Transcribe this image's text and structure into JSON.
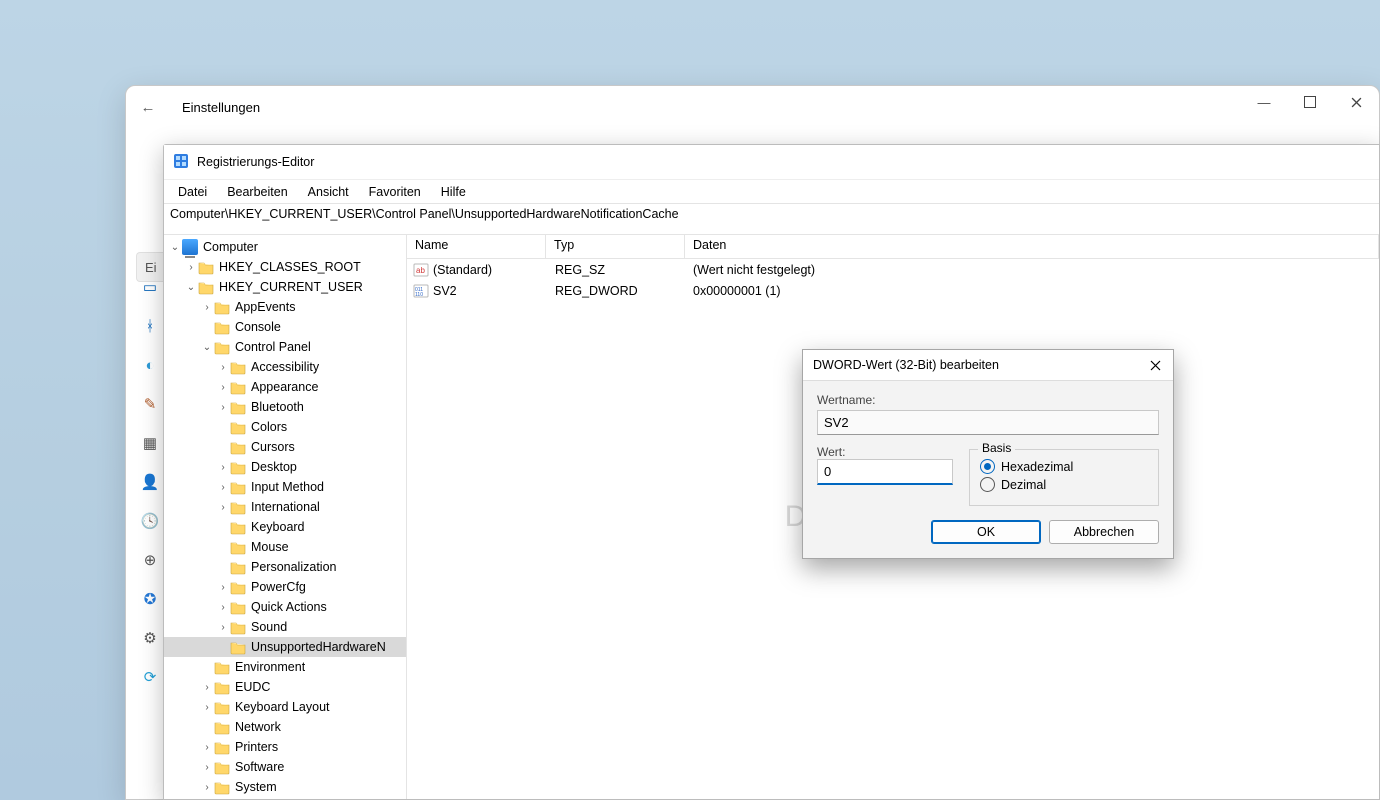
{
  "settings_window": {
    "title": "Einstellungen",
    "search_placeholder_fragment": "Ei"
  },
  "regedit": {
    "title": "Registrierungs-Editor",
    "menu": {
      "file": "Datei",
      "edit": "Bearbeiten",
      "view": "Ansicht",
      "favorites": "Favoriten",
      "help": "Hilfe"
    },
    "address": "Computer\\HKEY_CURRENT_USER\\Control Panel\\UnsupportedHardwareNotificationCache",
    "tree": {
      "root": "Computer",
      "hives": {
        "classes_root": "HKEY_CLASSES_ROOT",
        "current_user": "HKEY_CURRENT_USER"
      },
      "hkcu_children": {
        "appevents": "AppEvents",
        "console": "Console",
        "control_panel": "Control Panel",
        "environment": "Environment",
        "eudc": "EUDC",
        "keyboard_layout": "Keyboard Layout",
        "network": "Network",
        "printers": "Printers",
        "software": "Software",
        "system": "System"
      },
      "control_panel_children": {
        "accessibility": "Accessibility",
        "appearance": "Appearance",
        "bluetooth": "Bluetooth",
        "colors": "Colors",
        "cursors": "Cursors",
        "desktop": "Desktop",
        "input_method": "Input Method",
        "international": "International",
        "keyboard": "Keyboard",
        "mouse": "Mouse",
        "personalization": "Personalization",
        "powercfg": "PowerCfg",
        "quick_actions": "Quick Actions",
        "sound": "Sound",
        "unsupported_hw": "UnsupportedHardwareNotificationCache"
      },
      "selected": "UnsupportedHardwareNotificationCache"
    },
    "listview": {
      "headers": {
        "name": "Name",
        "type": "Typ",
        "data": "Daten"
      },
      "rows": [
        {
          "icon": "string",
          "name": "(Standard)",
          "type": "REG_SZ",
          "data": "(Wert nicht festgelegt)"
        },
        {
          "icon": "binary",
          "name": "SV2",
          "type": "REG_DWORD",
          "data": "0x00000001 (1)"
        }
      ]
    }
  },
  "dialog": {
    "title": "DWORD-Wert (32-Bit) bearbeiten",
    "name_label": "Wertname:",
    "name_value": "SV2",
    "value_label": "Wert:",
    "value_value": "0",
    "basis_label": "Basis",
    "radio_hex": "Hexadezimal",
    "radio_dec": "Dezimal",
    "selected_basis": "hex",
    "ok": "OK",
    "cancel": "Abbrechen"
  },
  "watermark": "Deskmodder.de"
}
